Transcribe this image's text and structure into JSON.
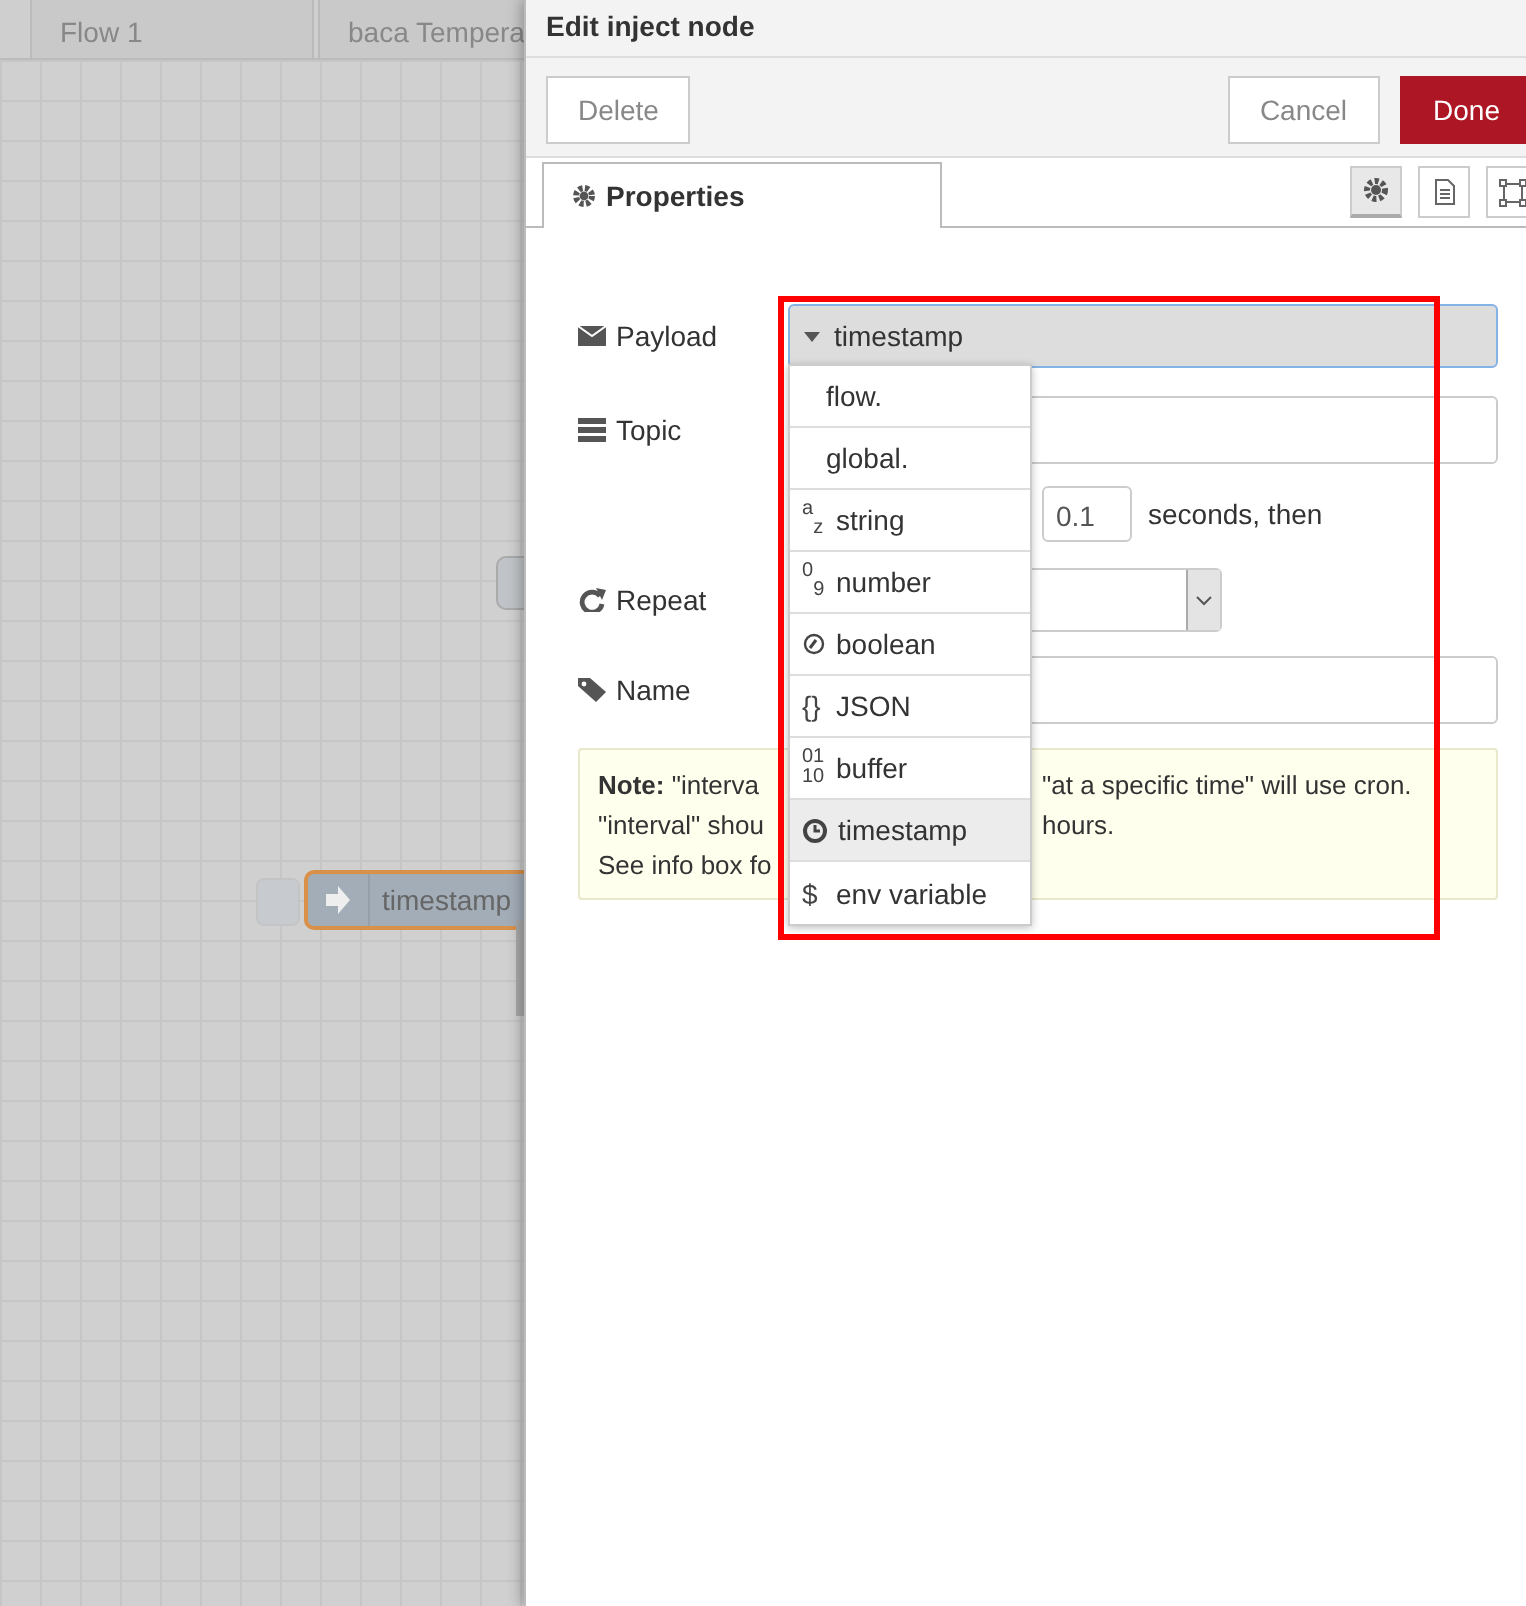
{
  "canvas": {
    "tabs": [
      {
        "label": "Flow 1"
      },
      {
        "label": "baca Tempera"
      }
    ],
    "nodes": [
      {
        "kind": "stub"
      },
      {
        "kind": "inject",
        "label": "timestamp"
      }
    ]
  },
  "tray": {
    "title": "Edit inject node",
    "buttons": [
      {
        "label": "Delete",
        "kind": "plain"
      },
      {
        "label": "Cancel",
        "kind": "plain"
      },
      {
        "label": "Done",
        "kind": "primary"
      }
    ],
    "tabs": [
      {
        "label": "Properties",
        "selected": true
      }
    ],
    "tab_icons": [
      {
        "kind": "gear",
        "selected": true
      },
      {
        "kind": "document",
        "selected": false
      },
      {
        "kind": "frame",
        "selected": false
      }
    ],
    "form": {
      "payload": {
        "label": "Payload",
        "value": "timestamp"
      },
      "topic": {
        "label": "Topic"
      },
      "delay": {
        "value": "0.1",
        "suffix": "seconds, then"
      },
      "repeat": {
        "label": "Repeat"
      },
      "name": {
        "label": "Name"
      }
    },
    "note": {
      "lines": [
        {
          "left": "**Note:** \"interva",
          "right": "\"at a specific time\" will use cron."
        },
        {
          "left": "\"interval\" shou",
          "right": "hours."
        },
        {
          "left": "See info box fo"
        }
      ]
    },
    "dropdown": {
      "items": [
        {
          "kind": "plain",
          "label": "flow.",
          "selected": false
        },
        {
          "kind": "plain",
          "label": "global.",
          "selected": false
        },
        {
          "kind": "glyph",
          "glyph": "$^{a}$$_{z}$",
          "label": "string",
          "selected": false
        },
        {
          "kind": "glyph",
          "glyph": "$^{0}$$_{9}$",
          "label": "number",
          "selected": false
        },
        {
          "kind": "boolean",
          "label": "boolean",
          "selected": false
        },
        {
          "kind": "glyph",
          "glyph": "{}",
          "label": "JSON",
          "selected": false
        },
        {
          "kind": "stacked",
          "glyph_lines": [
            "01",
            "10"
          ],
          "label": "buffer",
          "selected": false
        },
        {
          "kind": "timestamp",
          "label": "timestamp",
          "selected": true
        },
        {
          "kind": "glyph",
          "glyph": "$",
          "label": "env variable",
          "selected": false
        }
      ]
    }
  }
}
